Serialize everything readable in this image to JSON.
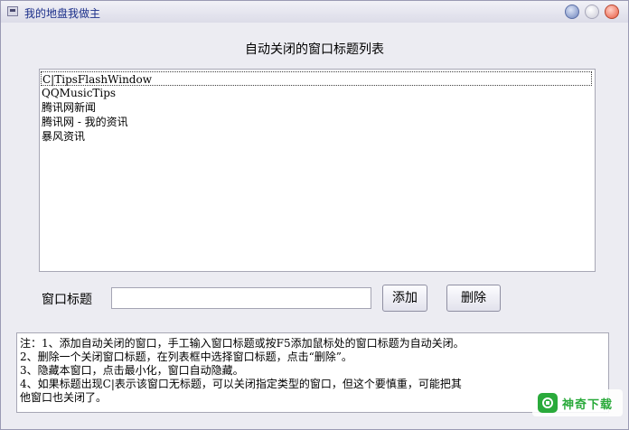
{
  "window": {
    "title": "我的地盘我做主"
  },
  "list": {
    "heading": "自动关闭的窗口标题列表",
    "items": [
      "C|TipsFlashWindow",
      "QQMusicTips",
      "腾讯网新闻",
      "腾讯网 - 我的资讯",
      "暴风资讯"
    ],
    "selected_index": 0
  },
  "form": {
    "label": "窗口标题",
    "input_value": "",
    "add_label": "添加",
    "delete_label": "删除"
  },
  "notes": {
    "lines": [
      "注：1、添加自动关闭的窗口，手工输入窗口标题或按F5添加鼠标处的窗口标题为自动关闭。",
      "2、删除一个关闭窗口标题，在列表框中选择窗口标题，点击“删除”。",
      "3、隐藏本窗口，点击最小化，窗口自动隐藏。",
      "4、如果标题出现C|表示该窗口无标题，可以关闭指定类型的窗口，但这个要慎重，可能把其",
      "他窗口也关闭了。"
    ]
  },
  "watermark": {
    "text": "神奇下载",
    "icon": "shenqi-logo-icon"
  }
}
